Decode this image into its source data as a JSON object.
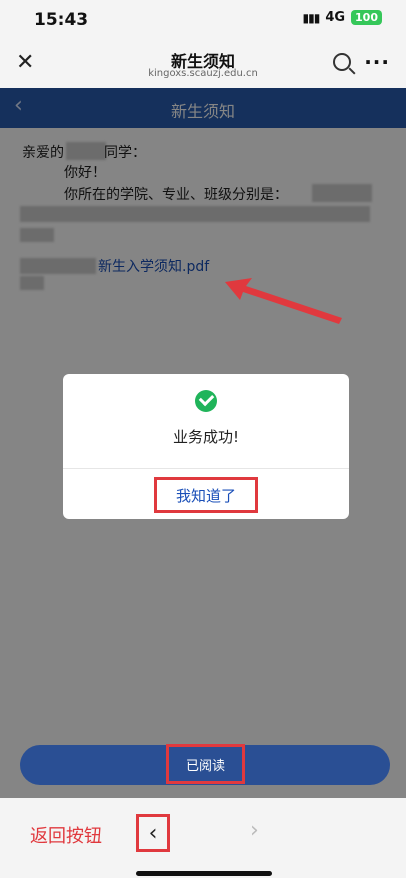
{
  "status": {
    "time": "15:43",
    "network": "4G",
    "battery": "100"
  },
  "browser": {
    "title": "新生须知",
    "url": "kingoxs.scauzj.edu.cn"
  },
  "appbar": {
    "title": "新生须知"
  },
  "content": {
    "greeting_prefix": "亲爱的",
    "greeting_suffix": "同学：",
    "hello": "你好！",
    "info": "你所在的学院、专业、班级分别是：",
    "pdf_link": "新生入学须知.pdf"
  },
  "dialog": {
    "message": "业务成功!",
    "ok_label": "我知道了"
  },
  "read_button": {
    "label": "已阅读"
  },
  "bottom": {
    "hint": "返回按钮"
  },
  "colors": {
    "primary": "#2a5db0",
    "highlight": "#e0393e",
    "success": "#20b45a",
    "link": "#1a4fb8"
  },
  "icons": {
    "close": "close-icon",
    "search": "search-icon",
    "more": "more-icon",
    "back": "chevron-left-icon",
    "forward": "chevron-right-icon",
    "check": "check-circle-icon"
  }
}
